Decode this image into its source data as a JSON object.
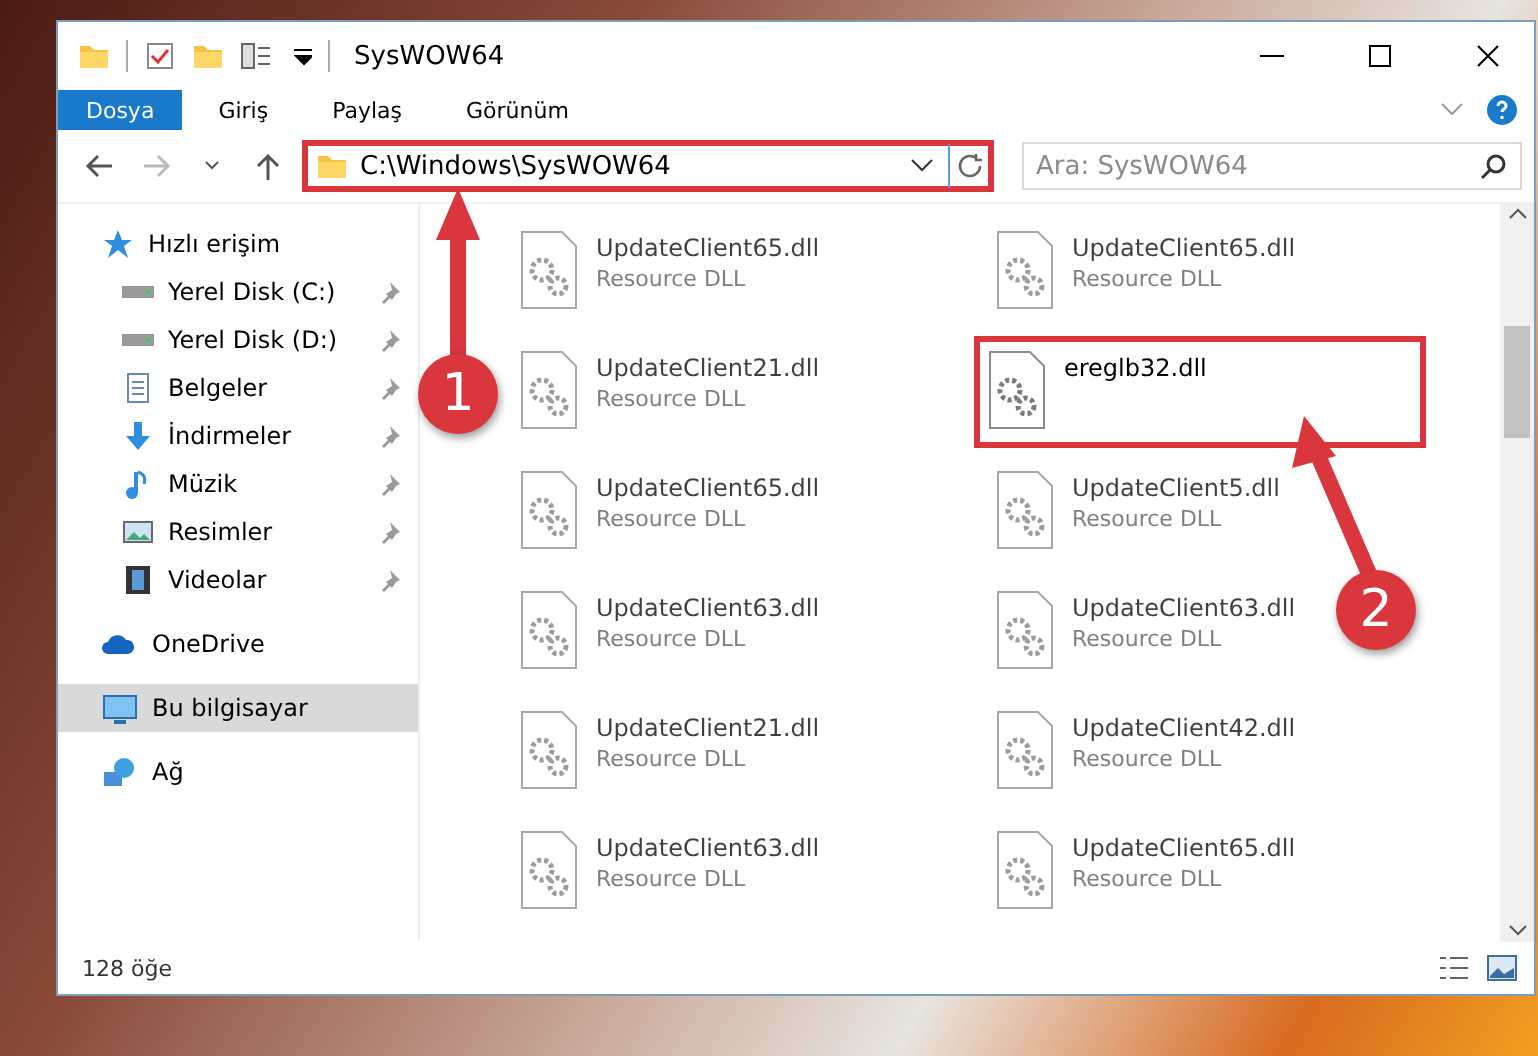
{
  "window": {
    "title": "SysWOW64"
  },
  "ribbon": {
    "tabs": [
      {
        "label": "Dosya",
        "selected": true
      },
      {
        "label": "Giriş",
        "selected": false
      },
      {
        "label": "Paylaş",
        "selected": false
      },
      {
        "label": "Görünüm",
        "selected": false
      }
    ]
  },
  "address_bar": {
    "path": "C:\\Windows\\SysWOW64",
    "highlighted": true
  },
  "search": {
    "placeholder": "Ara: SysWOW64"
  },
  "sidebar": {
    "items": [
      {
        "label": "Hızlı erişim",
        "kind": "star",
        "selected": false,
        "children": [
          {
            "label": "Yerel Disk (C:)",
            "kind": "drive",
            "pinned": true,
            "selected": false
          },
          {
            "label": "Yerel Disk (D:)",
            "kind": "drive",
            "pinned": true,
            "selected": false
          },
          {
            "label": "Belgeler",
            "kind": "document",
            "pinned": true,
            "selected": false
          },
          {
            "label": "İndirmeler",
            "kind": "download",
            "pinned": true,
            "selected": false
          },
          {
            "label": "Müzik",
            "kind": "music",
            "pinned": true,
            "selected": false
          },
          {
            "label": "Resimler",
            "kind": "picture",
            "pinned": true,
            "selected": false
          },
          {
            "label": "Videolar",
            "kind": "video",
            "pinned": true,
            "selected": false
          }
        ]
      },
      {
        "label": "OneDrive",
        "kind": "cloud",
        "selected": false
      },
      {
        "label": "Bu bilgisayar",
        "kind": "computer",
        "selected": true
      },
      {
        "label": "Ağ",
        "kind": "network",
        "selected": false
      }
    ]
  },
  "files": [
    {
      "name": "UpdateClient65.dll",
      "type": "Resource DLL",
      "faded": true,
      "highlighted": false
    },
    {
      "name": "UpdateClient65.dll",
      "type": "Resource DLL",
      "faded": true,
      "highlighted": false
    },
    {
      "name": "UpdateClient21.dll",
      "type": "Resource DLL",
      "faded": true,
      "highlighted": false
    },
    {
      "name": "ereglb32.dll",
      "faded": false,
      "highlighted": true
    },
    {
      "name": "UpdateClient65.dll",
      "type": "Resource DLL",
      "faded": true,
      "highlighted": false
    },
    {
      "name": "UpdateClient5.dll",
      "type": "Resource DLL",
      "faded": true,
      "highlighted": false
    },
    {
      "name": "UpdateClient63.dll",
      "type": "Resource DLL",
      "faded": true,
      "highlighted": false
    },
    {
      "name": "UpdateClient63.dll",
      "type": "Resource DLL",
      "faded": true,
      "highlighted": false
    },
    {
      "name": "UpdateClient21.dll",
      "type": "Resource DLL",
      "faded": true,
      "highlighted": false
    },
    {
      "name": "UpdateClient42.dll",
      "type": "Resource DLL",
      "faded": true,
      "highlighted": false
    },
    {
      "name": "UpdateClient63.dll",
      "type": "Resource DLL",
      "faded": true,
      "highlighted": false
    },
    {
      "name": "UpdateClient65.dll",
      "type": "Resource DLL",
      "faded": true,
      "highlighted": false
    }
  ],
  "callouts": [
    {
      "label": "1"
    },
    {
      "label": "2"
    }
  ],
  "status_bar": {
    "count": "128 öğe"
  }
}
